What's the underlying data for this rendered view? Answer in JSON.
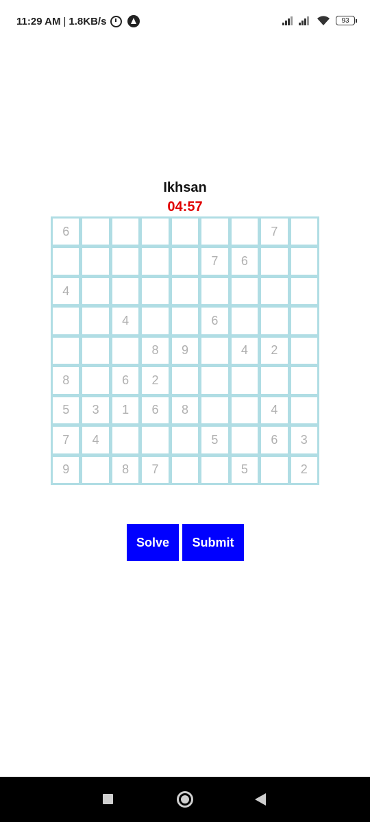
{
  "status_bar": {
    "time": "11:29 AM",
    "separator": "|",
    "network_speed": "1.8KB/s",
    "battery": "93",
    "icons": [
      "alarm-icon",
      "app-badge-icon",
      "signal-icon",
      "signal-icon",
      "wifi-icon",
      "battery-icon"
    ]
  },
  "game": {
    "player_name": "Ikhsan",
    "timer": "04:57",
    "grid": [
      [
        "6",
        "",
        "",
        "",
        "",
        "",
        "",
        "7",
        ""
      ],
      [
        "",
        "",
        "",
        "",
        "",
        "7",
        "6",
        "",
        ""
      ],
      [
        "4",
        "",
        "",
        "",
        "",
        "",
        "",
        "",
        ""
      ],
      [
        "",
        "",
        "4",
        "",
        "",
        "6",
        "",
        "",
        ""
      ],
      [
        "",
        "",
        "",
        "8",
        "9",
        "",
        "4",
        "2",
        ""
      ],
      [
        "8",
        "",
        "6",
        "2",
        "",
        "",
        "",
        "",
        ""
      ],
      [
        "5",
        "3",
        "1",
        "6",
        "8",
        "",
        "",
        "4",
        ""
      ],
      [
        "7",
        "4",
        "",
        "",
        "",
        "5",
        "",
        "6",
        "3"
      ],
      [
        "9",
        "",
        "8",
        "7",
        "",
        "",
        "5",
        "",
        "2"
      ]
    ],
    "colors": {
      "grid_border": "#b0dde4",
      "timer": "#e00000",
      "button": "#0000ff",
      "digit": "#b0b0b0"
    }
  },
  "buttons": {
    "solve_label": "Solve",
    "submit_label": "Submit"
  },
  "nav_bar": {
    "icons": [
      "recents-square-icon",
      "home-circle-icon",
      "back-triangle-icon"
    ]
  }
}
